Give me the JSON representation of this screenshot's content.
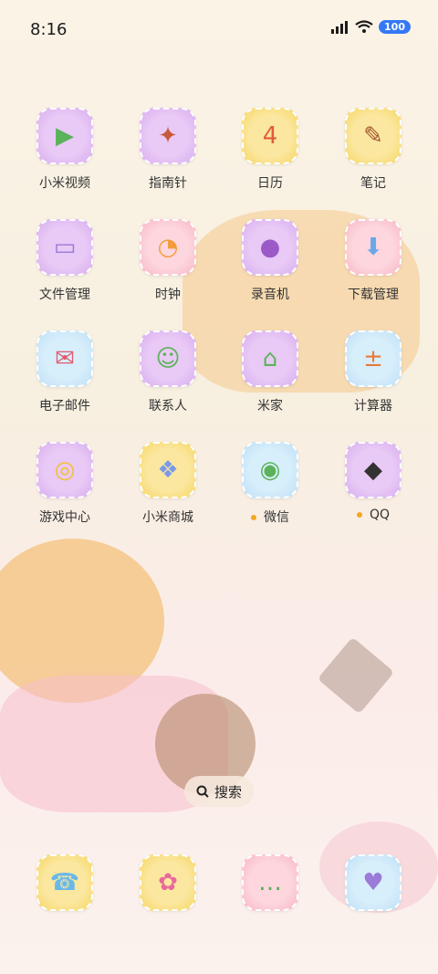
{
  "status_bar": {
    "time": "8:16",
    "battery": "100",
    "icons": [
      "signal-icon",
      "wifi-icon",
      "battery-icon"
    ]
  },
  "apps": [
    {
      "label": "小米视频",
      "icon": "video-play-icon",
      "glyph": "▶",
      "color": "#5ab35a",
      "tile": "purple"
    },
    {
      "label": "指南针",
      "icon": "compass-icon",
      "glyph": "✦",
      "color": "#c85a3a",
      "tile": "purple"
    },
    {
      "label": "日历",
      "icon": "calendar-icon",
      "glyph": "4",
      "color": "#e35a3a",
      "tile": "yellow"
    },
    {
      "label": "笔记",
      "icon": "notes-icon",
      "glyph": "✎",
      "color": "#a0522d",
      "tile": "yellow"
    },
    {
      "label": "文件管理",
      "icon": "folder-icon",
      "glyph": "▭",
      "color": "#9b7ad8",
      "tile": "purple"
    },
    {
      "label": "时钟",
      "icon": "clock-icon",
      "glyph": "◔",
      "color": "#f29c3a",
      "tile": "pink"
    },
    {
      "label": "录音机",
      "icon": "recorder-icon",
      "glyph": "●",
      "color": "#9b5ac8",
      "tile": "purple"
    },
    {
      "label": "下载管理",
      "icon": "download-icon",
      "glyph": "⬇",
      "color": "#6aa8e8",
      "tile": "pink"
    },
    {
      "label": "电子邮件",
      "icon": "mail-icon",
      "glyph": "✉",
      "color": "#e25a6a",
      "tile": "blue"
    },
    {
      "label": "联系人",
      "icon": "contacts-icon",
      "glyph": "☺",
      "color": "#5ab35a",
      "tile": "purple"
    },
    {
      "label": "米家",
      "icon": "home-icon",
      "glyph": "⌂",
      "color": "#5ab35a",
      "tile": "purple"
    },
    {
      "label": "计算器",
      "icon": "calculator-icon",
      "glyph": "±",
      "color": "#e87a3a",
      "tile": "blue"
    },
    {
      "label": "游戏中心",
      "icon": "gamepad-icon",
      "glyph": "◎",
      "color": "#f2c12e",
      "tile": "purple"
    },
    {
      "label": "小米商城",
      "icon": "gift-icon",
      "glyph": "❖",
      "color": "#7a9ae8",
      "tile": "yellow"
    },
    {
      "label": "微信",
      "icon": "wechat-icon",
      "glyph": "◉",
      "color": "#5ab35a",
      "tile": "blue",
      "dot": true
    },
    {
      "label": "QQ",
      "icon": "qq-penguin-icon",
      "glyph": "◆",
      "color": "#333333",
      "tile": "purple",
      "dot": true
    }
  ],
  "search": {
    "label": "搜索",
    "icon": "search-icon"
  },
  "dock": [
    {
      "icon": "phone-icon",
      "glyph": "☎",
      "color": "#6ab8e8",
      "tile": "yellow"
    },
    {
      "icon": "messages-icon",
      "glyph": "✿",
      "color": "#e86a9a",
      "tile": "yellow"
    },
    {
      "icon": "chat-icon",
      "glyph": "…",
      "color": "#5ab35a",
      "tile": "pink"
    },
    {
      "icon": "camera-icon",
      "glyph": "♥",
      "color": "#9b7ad8",
      "tile": "blue"
    }
  ]
}
